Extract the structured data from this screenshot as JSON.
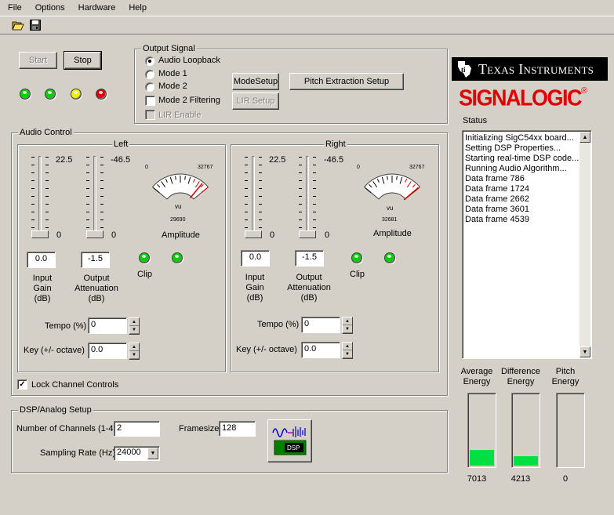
{
  "menu": {
    "file": "File",
    "options": "Options",
    "hardware": "Hardware",
    "help": "Help"
  },
  "toolbar": {
    "open_icon": "open-folder-icon",
    "save_icon": "save-disk-icon"
  },
  "controls": {
    "start": "Start",
    "stop": "Stop"
  },
  "leds": {
    "colors": [
      "#00d000",
      "#00d000",
      "#f0f000",
      "#e00000"
    ]
  },
  "output_signal": {
    "title": "Output Signal",
    "options": [
      "Audio Loopback",
      "Mode 1",
      "Mode 2"
    ],
    "selected": 0,
    "mode2_filtering": "Mode 2 Filtering",
    "lir_enable": "LIR Enable",
    "mode_setup": "ModeSetup",
    "lir_setup": "LIR Setup",
    "pitch_setup": "Pitch Extraction Setup"
  },
  "audio_control": {
    "title": "Audio Control",
    "lock_label": "Lock Channel Controls",
    "lock_checked": true,
    "left": {
      "title": "Left",
      "gain_max": "22.5",
      "gain_min": "0",
      "att_max": "-46.5",
      "att_min": "0",
      "vu_min": "0",
      "vu_max": "32767",
      "vu_label": "vu",
      "vu_reading": "29690",
      "vu_level": 0.89,
      "amplitude": "Amplitude",
      "input_gain": "0.0",
      "output_att": "-1.5",
      "input_gain_label": "Input\nGain\n(dB)",
      "output_att_label": "Output\nAttenuation\n(dB)",
      "clip": "Clip",
      "tempo_label": "Tempo (%)",
      "tempo": "0",
      "key_label": "Key (+/- octave)",
      "key": "0.0"
    },
    "right": {
      "title": "Right",
      "gain_max": "22.5",
      "gain_min": "0",
      "att_max": "-46.5",
      "att_min": "0",
      "vu_min": "0",
      "vu_max": "32767",
      "vu_label": "vu",
      "vu_reading": "32681",
      "vu_level": 0.99,
      "amplitude": "Amplitude",
      "input_gain": "0.0",
      "output_att": "-1.5",
      "input_gain_label": "Input\nGain\n(dB)",
      "output_att_label": "Output\nAttenuation\n(dB)",
      "clip": "Clip",
      "tempo_label": "Tempo (%)",
      "tempo": "0",
      "key_label": "Key (+/- octave)",
      "key": "0.0"
    }
  },
  "dsp_setup": {
    "title": "DSP/Analog Setup",
    "channels_label": "Number of Channels (1-4)",
    "channels": "2",
    "framesize_label": "Framesize",
    "framesize": "128",
    "rate_label": "Sampling Rate (Hz)",
    "rate": "24000",
    "dsp_button_text": "DSP"
  },
  "branding": {
    "ti": "Texas Instruments",
    "signalogic": "SIGNALOGIC",
    "reg": "®"
  },
  "status": {
    "title": "Status",
    "lines": [
      "Initializing SigC54xx board...",
      "Setting DSP Properties...",
      "Starting real-time DSP code...",
      "Running  Audio  Algorithm...",
      "Data frame 786",
      "Data frame 1724",
      "Data frame 2662",
      "Data frame 3601",
      "Data frame 4539"
    ]
  },
  "energy": [
    {
      "label": "Average\nEnergy",
      "value": "7013",
      "level": 0.22
    },
    {
      "label": "Difference\nEnergy",
      "value": "4213",
      "level": 0.13
    },
    {
      "label": "Pitch\nEnergy",
      "value": "0",
      "level": 0
    }
  ]
}
